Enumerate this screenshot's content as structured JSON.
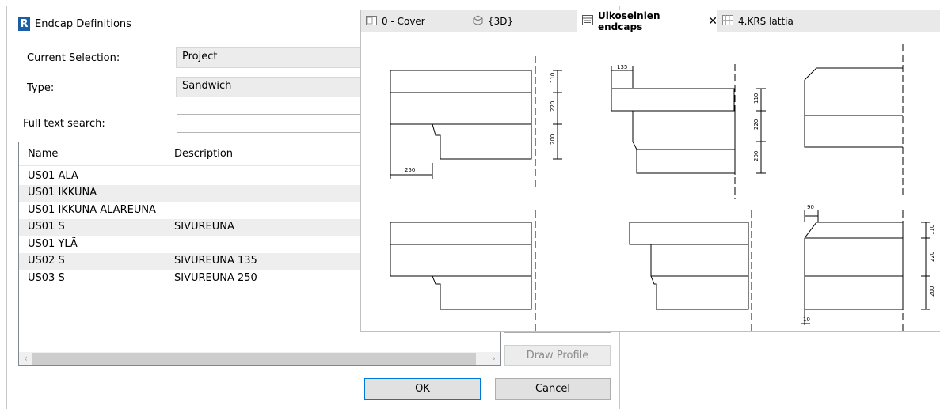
{
  "dialog": {
    "title": "Endcap Definitions",
    "logo_letter": "R",
    "current_selection_label": "Current Selection:",
    "current_selection_value": "Project",
    "type_label": "Type:",
    "type_value": "Sandwich",
    "search_label": "Full text search:",
    "search_value": "",
    "columns": [
      "Name",
      "Description"
    ],
    "rows": [
      {
        "name": "US01 ALA",
        "description": ""
      },
      {
        "name": "US01 IKKUNA",
        "description": ""
      },
      {
        "name": "US01 IKKUNA ALAREUNA",
        "description": ""
      },
      {
        "name": "US01 S",
        "description": "SIVUREUNA"
      },
      {
        "name": "US01 YLÄ",
        "description": ""
      },
      {
        "name": "US02 S",
        "description": "SIVUREUNA 135"
      },
      {
        "name": "US03 S",
        "description": "SIVUREUNA 250"
      }
    ],
    "draw_profile_label": "Draw Profile",
    "ok_label": "OK",
    "cancel_label": "Cancel"
  },
  "revit": {
    "tabs": [
      {
        "label": "0 - Cover",
        "icon": "sheet-icon",
        "active": false
      },
      {
        "label": "{3D}",
        "icon": "3d-view-icon",
        "active": false
      },
      {
        "label": "Ulkoseinien endcaps",
        "icon": "drafting-view-icon",
        "active": true
      },
      {
        "label": "4.KRS lattia",
        "icon": "floor-plan-icon",
        "active": false
      }
    ],
    "dimensions": {
      "d110": "110",
      "d220": "220",
      "d200": "200",
      "d250": "250",
      "d135": "135",
      "d90": "90",
      "d10": "10"
    }
  },
  "colors": {
    "accent": "#0078d7",
    "revit_logo": "#1a5ea8"
  }
}
